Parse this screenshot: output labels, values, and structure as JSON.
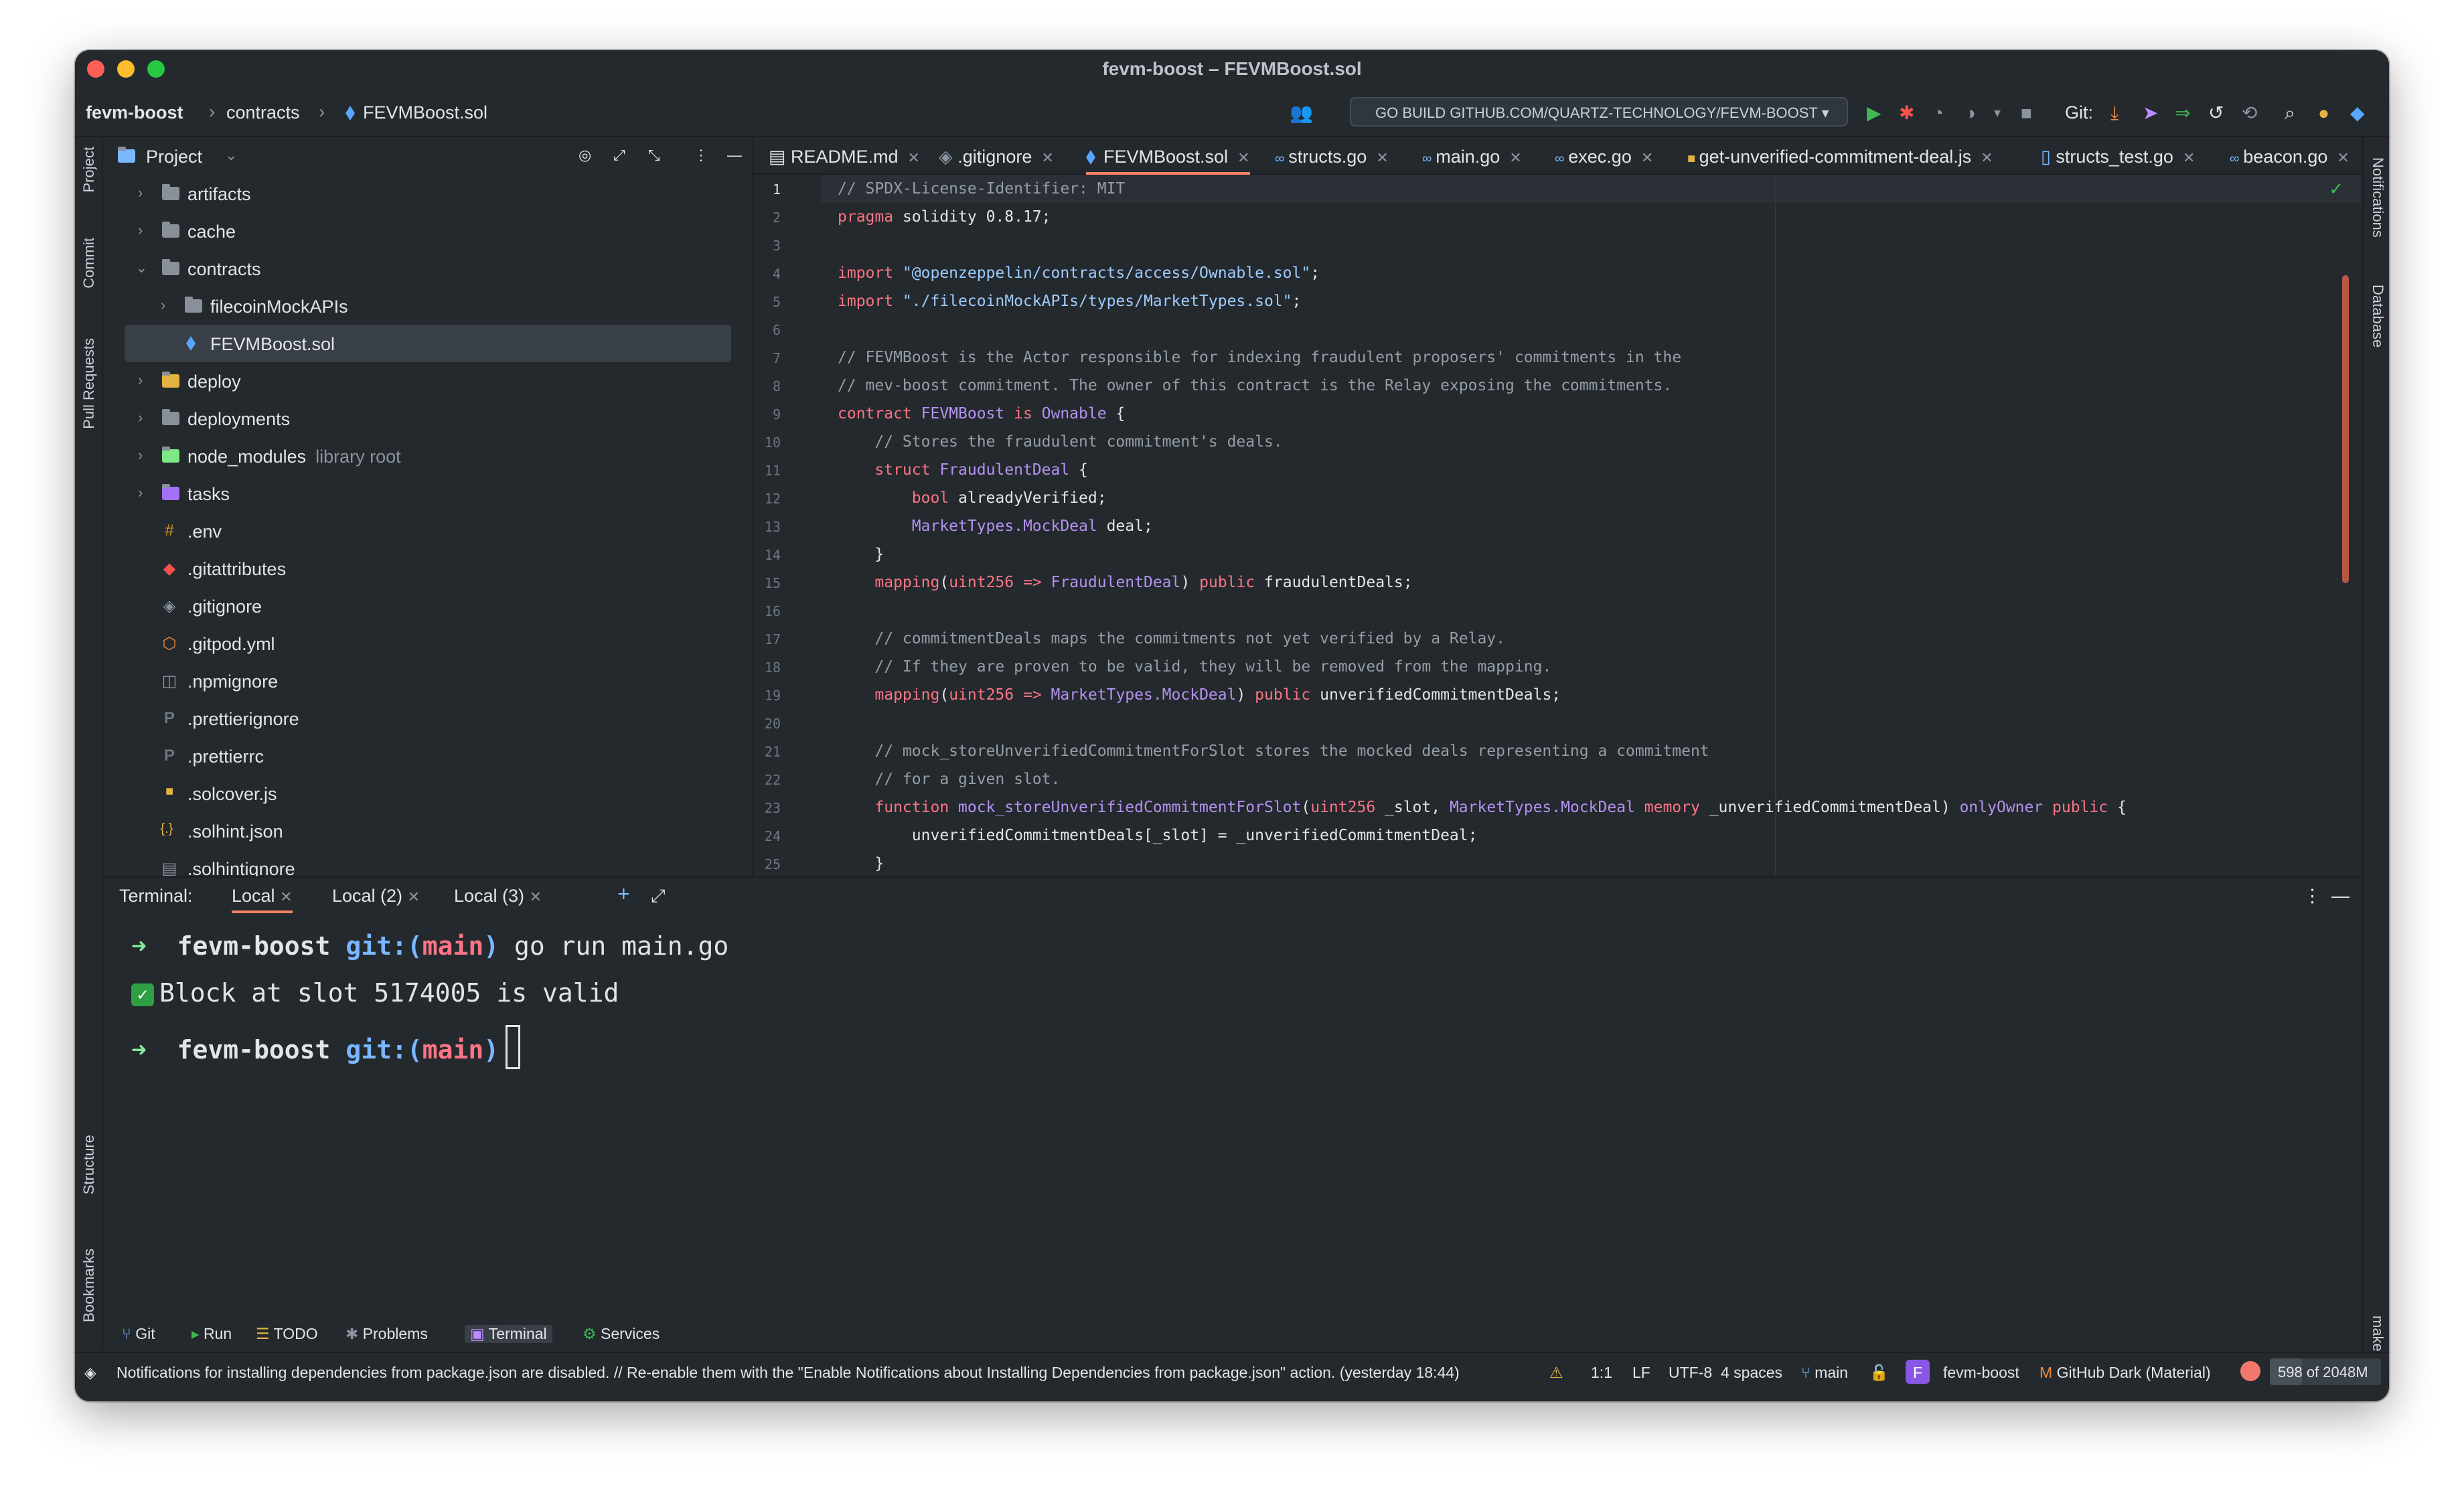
{
  "window": {
    "title": "fevm-boost – FEVMBoost.sol"
  },
  "breadcrumb": {
    "project": "fevm-boost",
    "folder": "contracts",
    "file": "FEVMBoost.sol"
  },
  "run_config": {
    "label": "GO BUILD GITHUB.COM/QUARTZ-TECHNOLOGY/FEVM-BOOST"
  },
  "git_label": "Git:",
  "left_strip": {
    "project": "Project",
    "commit": "Commit",
    "pull_requests": "Pull Requests",
    "structure": "Structure",
    "bookmarks": "Bookmarks"
  },
  "right_strip": {
    "notifications": "Notifications",
    "database": "Database",
    "make": "make"
  },
  "project_panel": {
    "title": "Project",
    "tree": [
      {
        "label": "artifacts",
        "kind": "folder"
      },
      {
        "label": "cache",
        "kind": "folder"
      },
      {
        "label": "contracts",
        "kind": "folder"
      },
      {
        "label": "filecoinMockAPIs",
        "kind": "folder"
      },
      {
        "label": "FEVMBoost.sol",
        "kind": "sol"
      },
      {
        "label": "deploy",
        "kind": "folder"
      },
      {
        "label": "deployments",
        "kind": "folder"
      },
      {
        "label": "node_modules",
        "hint": "library root",
        "kind": "folder"
      },
      {
        "label": "tasks",
        "kind": "folder"
      },
      {
        "label": ".env",
        "kind": "file"
      },
      {
        "label": ".gitattributes",
        "kind": "file"
      },
      {
        "label": ".gitignore",
        "kind": "file"
      },
      {
        "label": ".gitpod.yml",
        "kind": "file"
      },
      {
        "label": ".npmignore",
        "kind": "file"
      },
      {
        "label": ".prettierignore",
        "kind": "file"
      },
      {
        "label": ".prettierrc",
        "kind": "file"
      },
      {
        "label": ".solcover.js",
        "kind": "file"
      },
      {
        "label": ".solhint.json",
        "kind": "file"
      },
      {
        "label": ".solhintignore",
        "kind": "file"
      }
    ]
  },
  "tabs": [
    {
      "label": "README.md"
    },
    {
      "label": ".gitignore"
    },
    {
      "label": "FEVMBoost.sol"
    },
    {
      "label": "structs.go"
    },
    {
      "label": "main.go"
    },
    {
      "label": "exec.go"
    },
    {
      "label": "get-unverified-commitment-deal.js"
    },
    {
      "label": "structs_test.go"
    },
    {
      "label": "beacon.go"
    }
  ],
  "editor": {
    "line_numbers": [
      "1",
      "2",
      "3",
      "4",
      "5",
      "6",
      "7",
      "8",
      "9",
      "10",
      "11",
      "12",
      "13",
      "14",
      "15",
      "16",
      "17",
      "18",
      "19",
      "20",
      "21",
      "22",
      "23",
      "24",
      "25"
    ],
    "lines": {
      "l1": "// SPDX-License-Identifier: MIT",
      "l2a": "pragma",
      "l2b": " solidity 0.8.17;",
      "l4a": "import ",
      "l4b": "\"@openzeppelin/contracts/access/Ownable.sol\"",
      "l4c": ";",
      "l5a": "import ",
      "l5b": "\"./filecoinMockAPIs/types/MarketTypes.sol\"",
      "l5c": ";",
      "l7": "// FEVMBoost is the Actor responsible for indexing fraudulent proposers' commitments in the",
      "l8": "// mev-boost commitment. The owner of this contract is the Relay exposing the commitments.",
      "l9a": "contract ",
      "l9b": "FEVMBoost",
      "l9c": " is ",
      "l9d": "Ownable",
      "l9e": " {",
      "l10": "    // Stores the fraudulent commitment's deals.",
      "l11a": "    struct ",
      "l11b": "FraudulentDeal",
      "l11c": " {",
      "l12a": "        bool",
      "l12b": " alreadyVerified;",
      "l13a": "        MarketTypes.MockDeal",
      "l13b": " deal;",
      "l14": "    }",
      "l15a": "    mapping",
      "l15b": "(",
      "l15c": "uint256",
      "l15d": " => ",
      "l15e": "FraudulentDeal",
      "l15f": ") ",
      "l15g": "public",
      "l15h": " fraudulentDeals;",
      "l17": "    // commitmentDeals maps the commitments not yet verified by a Relay.",
      "l18": "    // If they are proven to be valid, they will be removed from the mapping.",
      "l19a": "    mapping",
      "l19b": "(",
      "l19c": "uint256",
      "l19d": " => ",
      "l19e": "MarketTypes.MockDeal",
      "l19f": ") ",
      "l19g": "public",
      "l19h": " unverifiedCommitmentDeals;",
      "l21": "    // mock_storeUnverifiedCommitmentForSlot stores the mocked deals representing a commitment",
      "l22": "    // for a given slot.",
      "l23a": "    function ",
      "l23b": "mock_storeUnverifiedCommitmentForSlot",
      "l23c": "(",
      "l23d": "uint256",
      "l23e": " _slot, ",
      "l23f": "MarketTypes.MockDeal",
      "l23g": " memory",
      "l23h": " _unverifiedCommitmentDeal) ",
      "l23i": "onlyOwner",
      "l23j": " public",
      "l23k": " {",
      "l24": "        unverifiedCommitmentDeals[_slot] = _unverifiedCommitmentDeal;",
      "l25": "    }"
    }
  },
  "terminal": {
    "label": "Terminal:",
    "tabs": [
      "Local",
      "Local (2)",
      "Local (3)"
    ],
    "line1": {
      "arrow": "➜",
      "dir": "fevm-boost",
      "git": "git:(",
      "branch": "main",
      "close": ")",
      "cmd": " go run main.go"
    },
    "line2": {
      "check": "✓",
      "text": "Block at slot 5174005 is valid"
    },
    "line3": {
      "arrow": "➜",
      "dir": "fevm-boost",
      "git": "git:(",
      "branch": "main",
      "close": ")"
    }
  },
  "bottom_tools": [
    "Git",
    "Run",
    "TODO",
    "Problems",
    "Terminal",
    "Services"
  ],
  "status": {
    "message": "Notifications for installing dependencies from package.json are disabled. // Re-enable them with the \"Enable Notifications about Installing Dependencies from package.json\" action. (yesterday 18:44)",
    "position": "1:1",
    "line_ending": "LF",
    "encoding": "UTF-8",
    "indent": "4 spaces",
    "branch": "main",
    "project_badge": "F",
    "project": "fevm-boost",
    "theme": "GitHub Dark (Material)",
    "memory": "598 of 2048M",
    "memory_used_fraction": 0.29
  }
}
